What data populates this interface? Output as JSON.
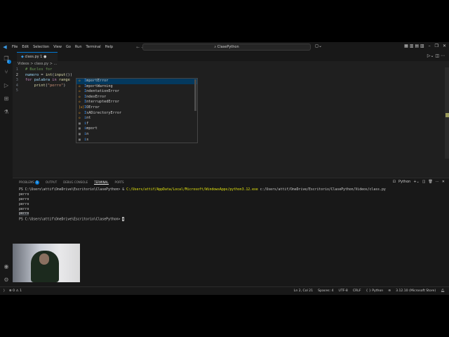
{
  "titlebar": {
    "menu": [
      "File",
      "Edit",
      "Selection",
      "View",
      "Go",
      "Run",
      "Terminal",
      "Help"
    ],
    "search": "ClasePython"
  },
  "tab": {
    "label": "class.py",
    "problems": "1"
  },
  "breadcrumb": "Videos > class.py > ...",
  "code": [
    {
      "n": "1",
      "parts": [
        [
          "cm",
          "# Bucles for"
        ]
      ]
    },
    {
      "n": "2",
      "parts": [
        [
          "var",
          "numero"
        ],
        [
          "op",
          " = "
        ],
        [
          "fn",
          "int"
        ],
        [
          "op",
          "("
        ],
        [
          "fn",
          "input"
        ],
        [
          "op",
          "()"
        ],
        [
          "op",
          ")"
        ]
      ]
    },
    {
      "n": "3",
      "parts": [
        [
          "kw",
          "for "
        ],
        [
          "var",
          "palabra "
        ],
        [
          "kw",
          "in "
        ],
        [
          "fn",
          "range"
        ]
      ]
    },
    {
      "n": "4",
      "parts": [
        [
          "op",
          "    "
        ],
        [
          "fn",
          "print"
        ],
        [
          "op",
          "("
        ],
        [
          "str",
          "\"perro\""
        ],
        [
          "op",
          ")"
        ]
      ]
    },
    {
      "n": "5",
      "parts": []
    }
  ],
  "suggestions": [
    {
      "icon": "class",
      "label": "ImportError"
    },
    {
      "icon": "class",
      "label": "ImportWarning"
    },
    {
      "icon": "class",
      "label": "IndentationError"
    },
    {
      "icon": "class",
      "label": "IndexError"
    },
    {
      "icon": "class",
      "label": "InterruptedError"
    },
    {
      "icon": "variable",
      "label": "IOError"
    },
    {
      "icon": "class",
      "label": "IsADirectoryError"
    },
    {
      "icon": "class",
      "label": "int"
    },
    {
      "icon": "keyword",
      "label": "if"
    },
    {
      "icon": "keyword",
      "label": "import"
    },
    {
      "icon": "keyword",
      "label": "in"
    },
    {
      "icon": "keyword",
      "label": "is"
    }
  ],
  "panel": {
    "tabs": [
      "PROBLEMS",
      "OUTPUT",
      "DEBUG CONSOLE",
      "TERMINAL",
      "PORTS"
    ],
    "problems_count": "1",
    "shell": "Python"
  },
  "terminal": {
    "prompt1": "PS C:\\Users\\attif\\OneDrive\\Escritorio\\ClasePython> ",
    "cmd_amp": "& ",
    "cmd_exe": "C:/Users/attif/AppData/Local/Microsoft/WindowsApps/python3.12.exe",
    "cmd_arg": " c:/Users/attif/OneDrive/Escritorio/ClasePython/Videos/class.py",
    "output": [
      "perro",
      "perro",
      "perro",
      "perro",
      "perro"
    ],
    "prompt2": "PS C:\\Users\\attif\\OneDrive\\Escritorio\\ClasePython> "
  },
  "status": {
    "errors": "0",
    "warnings": "1",
    "position": "Ln 2, Col 21",
    "spaces": "Spaces: 4",
    "encoding": "UTF-8",
    "eol": "CRLF",
    "language": "Python",
    "interpreter": "3.12.10 (Microsoft Store)"
  }
}
